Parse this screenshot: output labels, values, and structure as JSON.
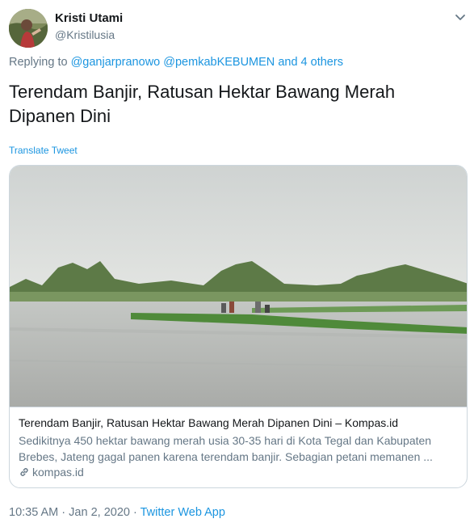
{
  "author": {
    "name": "Kristi Utami",
    "handle": "@Kristilusia"
  },
  "replying": {
    "prefix": "Replying to",
    "mentions": [
      "@ganjarpranowo",
      "@pemkabKEBUMEN"
    ],
    "and": "and",
    "others": "4 others"
  },
  "tweet": {
    "text": "Terendam Banjir, Ratusan Hektar Bawang Merah Dipanen Dini",
    "translate_label": "Translate Tweet"
  },
  "card": {
    "title": "Terendam Banjir, Ratusan Hektar Bawang Merah Dipanen Dini – Kompas.id",
    "description": "Sedikitnya 450 hektar bawang merah usia 30-35 hari di Kota Tegal dan Kabupaten Brebes, Jateng gagal panen karena terendam banjir. Sebagian petani memanen ...",
    "domain": "kompas.id"
  },
  "meta": {
    "time": "10:35 AM",
    "separator": "·",
    "date": "Jan 2, 2020",
    "source": "Twitter Web App"
  },
  "colors": {
    "link": "#1b95e0",
    "secondary_text": "#657786",
    "primary_text": "#14171a",
    "border": "#ccd6dd"
  },
  "icons": {
    "menu": "chevron-down-icon",
    "card_domain": "link-icon"
  }
}
